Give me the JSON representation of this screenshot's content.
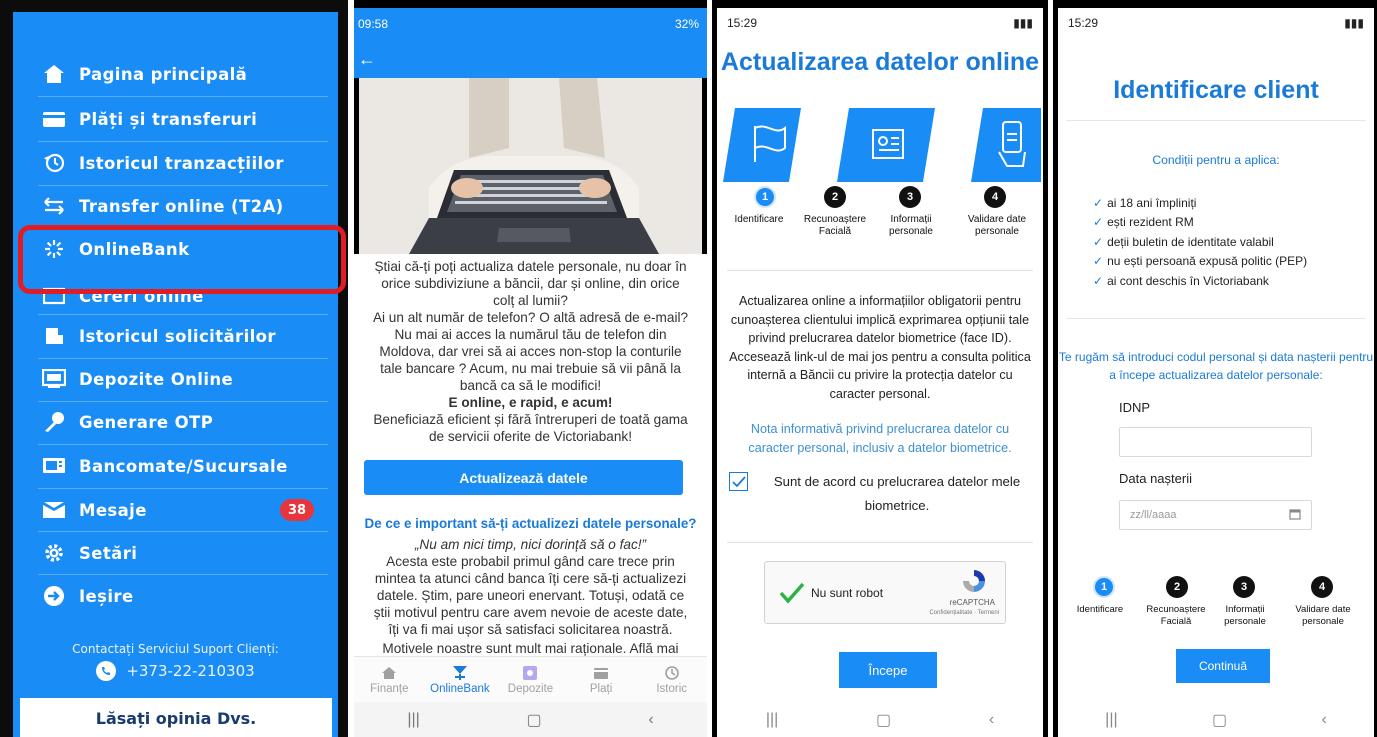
{
  "panel1": {
    "menu": [
      {
        "label": "Pagina principală",
        "icon": "home-icon"
      },
      {
        "label": "Plăți și transferuri",
        "icon": "card-icon"
      },
      {
        "label": "Istoricul tranzacțiilor",
        "icon": "history-icon"
      },
      {
        "label": "Transfer online (T2A)",
        "icon": "transfer-icon"
      },
      {
        "label": "OnlineBank",
        "icon": "onlinebank-icon"
      },
      {
        "label": "Cereri online",
        "icon": "requests-icon"
      },
      {
        "label": "Istoricul solicitărilor",
        "icon": "request-history-icon"
      },
      {
        "label": "Depozite Online",
        "icon": "deposit-icon"
      },
      {
        "label": "Generare OTP",
        "icon": "key-icon"
      },
      {
        "label": "Bancomate/Sucursale",
        "icon": "atm-icon"
      },
      {
        "label": "Mesaje",
        "icon": "mail-icon"
      },
      {
        "label": "Setări",
        "icon": "gear-icon"
      },
      {
        "label": "Ieșire",
        "icon": "exit-icon"
      }
    ],
    "messages_badge": "38",
    "contact_label": "Contactați Serviciul Suport Clienți:",
    "contact_phone": "+373-22-210303",
    "opinion_button": "Lăsați opinia Dvs.",
    "highlight_color": "#e01c24",
    "background_color": "#1a8cf5"
  },
  "panel2": {
    "status_time": "09:58",
    "status_battery": "32%",
    "intro_lines": [
      "Știai că-ți poți actualiza datele personale, nu doar în",
      "orice subdiviziune a băncii, dar și online, din orice",
      "colț al lumii?",
      "Ai un alt număr de telefon? O altă adresă de e-mail?",
      "Nu mai ai acces la numărul tău de telefon din",
      "Moldova, dar vrei să ai acces non-stop la conturile",
      "tale bancare ? Acum, nu mai trebuie să vii până la",
      "bancă ca să le modifici!"
    ],
    "bold_line": "E online, e rapid, e acum!",
    "benefit_lines": [
      "Beneficiază eficient și fără întreruperi de toată gama",
      "de servicii oferite de Victoriabank!"
    ],
    "cta_button": "Actualizează datele",
    "why_heading": "De ce e important să-ți actualizezi datele personale?",
    "quote": "„Nu am nici timp, nici dorință să o fac!”",
    "body_lines": [
      "Acesta este probabil primul gând care trece prin",
      "mintea ta atunci când banca îți cere să-ți actualizezi",
      "datele. Știm, pare uneori enervant. Totuși, odată ce",
      "știi motivul pentru care avem nevoie de aceste date,",
      "îți va fi mai ușor să satisfaci solicitarea noastră.",
      "Motivele noastre sunt mult mai raționale. Află mai"
    ],
    "tabs": [
      {
        "label": "Finanțe",
        "icon": "home-icon"
      },
      {
        "label": "OnlineBank",
        "icon": "onlinebank-icon"
      },
      {
        "label": "Depozite",
        "icon": "deposit-icon"
      },
      {
        "label": "Plați",
        "icon": "wallet-icon"
      },
      {
        "label": "Istoric",
        "icon": "history-icon"
      }
    ],
    "active_tab": "OnlineBank"
  },
  "panel3": {
    "status_time": "15:29",
    "title": "Actualizarea datelor online",
    "steps": [
      {
        "num": "1",
        "label": "Identificare"
      },
      {
        "num": "2",
        "label": "Recunoaștere Facială"
      },
      {
        "num": "3",
        "label": "Informații personale"
      },
      {
        "num": "4",
        "label": "Validare date personale"
      }
    ],
    "paragraph": "Actualizarea online a informațiilor obligatorii pentru cunoașterea clientului implică exprimarea opțiunii tale privind prelucrarea datelor biometrice (face ID). Accesează link-ul de mai jos pentru a consulta politica internă a Băncii cu privire la protecția datelor cu caracter personal.",
    "link": "Nota informativă privind prelucrarea datelor cu caracter personal, inclusiv a datelor biometrice.",
    "agree": "Sunt de acord cu prelucrarea datelor mele biometrice.",
    "captcha_label": "Nu sunt robot",
    "captcha_brand": "reCAPTCHA",
    "captcha_links": "Confidențialitate · Termeni",
    "start_button": "Începe"
  },
  "panel4": {
    "status_time": "15:29",
    "title": "Identificare client",
    "conditions_title": "Condiții pentru a aplica:",
    "conditions": [
      "ai 18 ani împliniți",
      "ești rezident RM",
      "deții buletin de identitate valabil",
      "nu ești persoană expusă politic (PEP)",
      "ai cont deschis în Victoriabank"
    ],
    "ask": "Te rugăm să introduci codul personal și data nașterii pentru a începe actualizarea datelor personale:",
    "idnp_label": "IDNP",
    "birth_label": "Data nașterii",
    "birth_placeholder": "zz/ll/aaaa",
    "steps": [
      {
        "num": "1",
        "label": "Identificare"
      },
      {
        "num": "2",
        "label": "Recunoaștere Facială"
      },
      {
        "num": "3",
        "label": "Informații personale"
      },
      {
        "num": "4",
        "label": "Validare date personale"
      }
    ],
    "continue_button": "Continuă"
  },
  "colors": {
    "brand_blue": "#1a8cf5",
    "link_blue": "#1a7ad8"
  }
}
